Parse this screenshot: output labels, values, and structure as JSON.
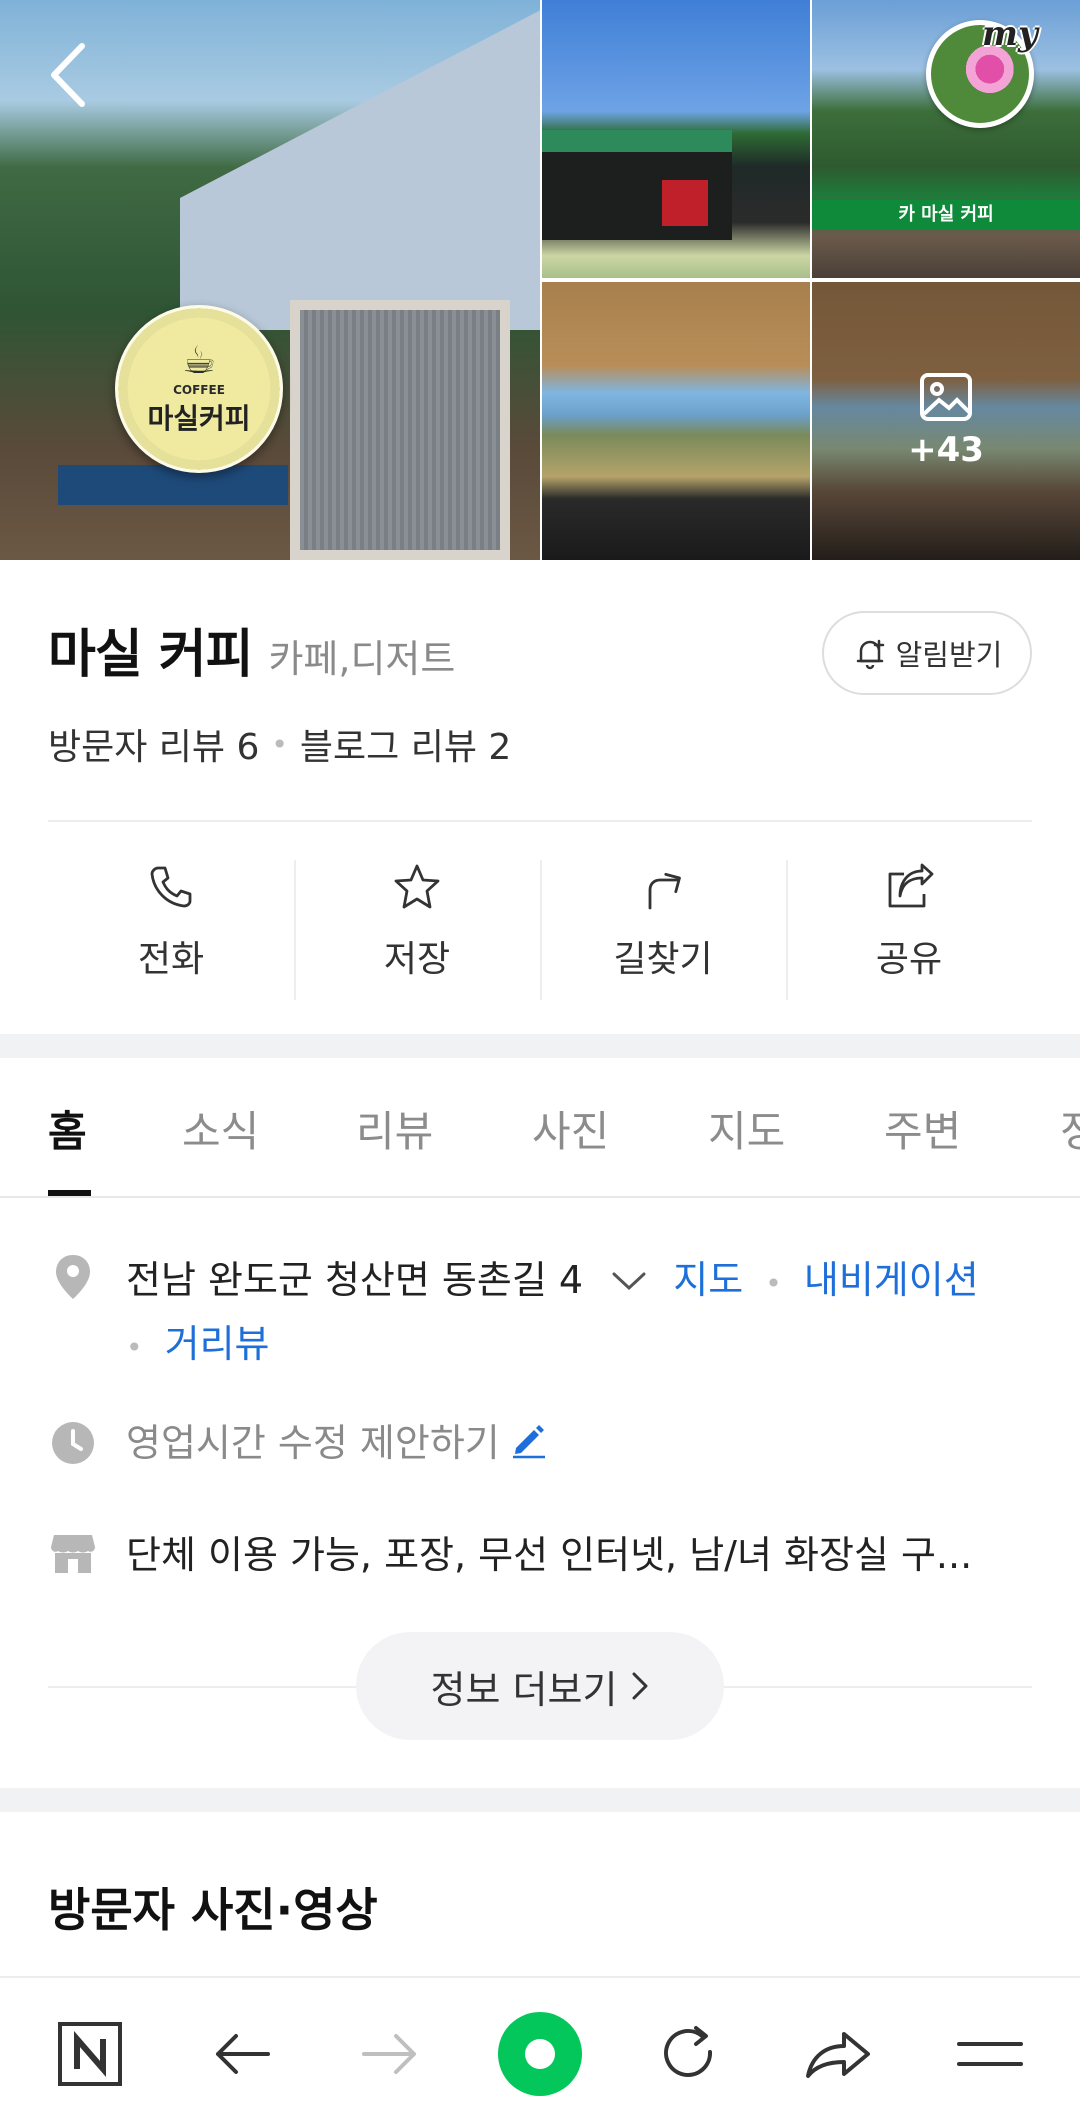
{
  "place": {
    "name": "마실 커피",
    "category": "카페,디저트",
    "visitor_reviews": "방문자 리뷰 6",
    "blog_reviews": "블로그 리뷰 2",
    "notify_label": "알림받기"
  },
  "photos": {
    "sign_text": "마실커피",
    "sign_sub": "COFFEE",
    "banner_text": "카 마실 커피",
    "avatar_badge": "my",
    "more_count": "+43"
  },
  "actions": [
    {
      "label": "전화",
      "icon": "phone-icon"
    },
    {
      "label": "저장",
      "icon": "star-icon"
    },
    {
      "label": "길찾기",
      "icon": "directions-icon"
    },
    {
      "label": "공유",
      "icon": "share-icon"
    }
  ],
  "tabs": [
    "홈",
    "소식",
    "리뷰",
    "사진",
    "지도",
    "주변",
    "정"
  ],
  "info": {
    "address": "전남 완도군 청산면 동촌길 4",
    "link_map": "지도",
    "link_navigation": "내비게이션",
    "link_streetview": "거리뷰",
    "hours_suggest": "영업시간 수정 제안하기",
    "amenities": "단체 이용 가능, 포장, 무선 인터넷, 남/녀 화장실 구...",
    "more_info": "정보 더보기"
  },
  "section": {
    "visitor_media_title": "방문자 사진·영상"
  },
  "colors": {
    "link": "#1e6fd9",
    "naver_green": "#03c75a"
  }
}
